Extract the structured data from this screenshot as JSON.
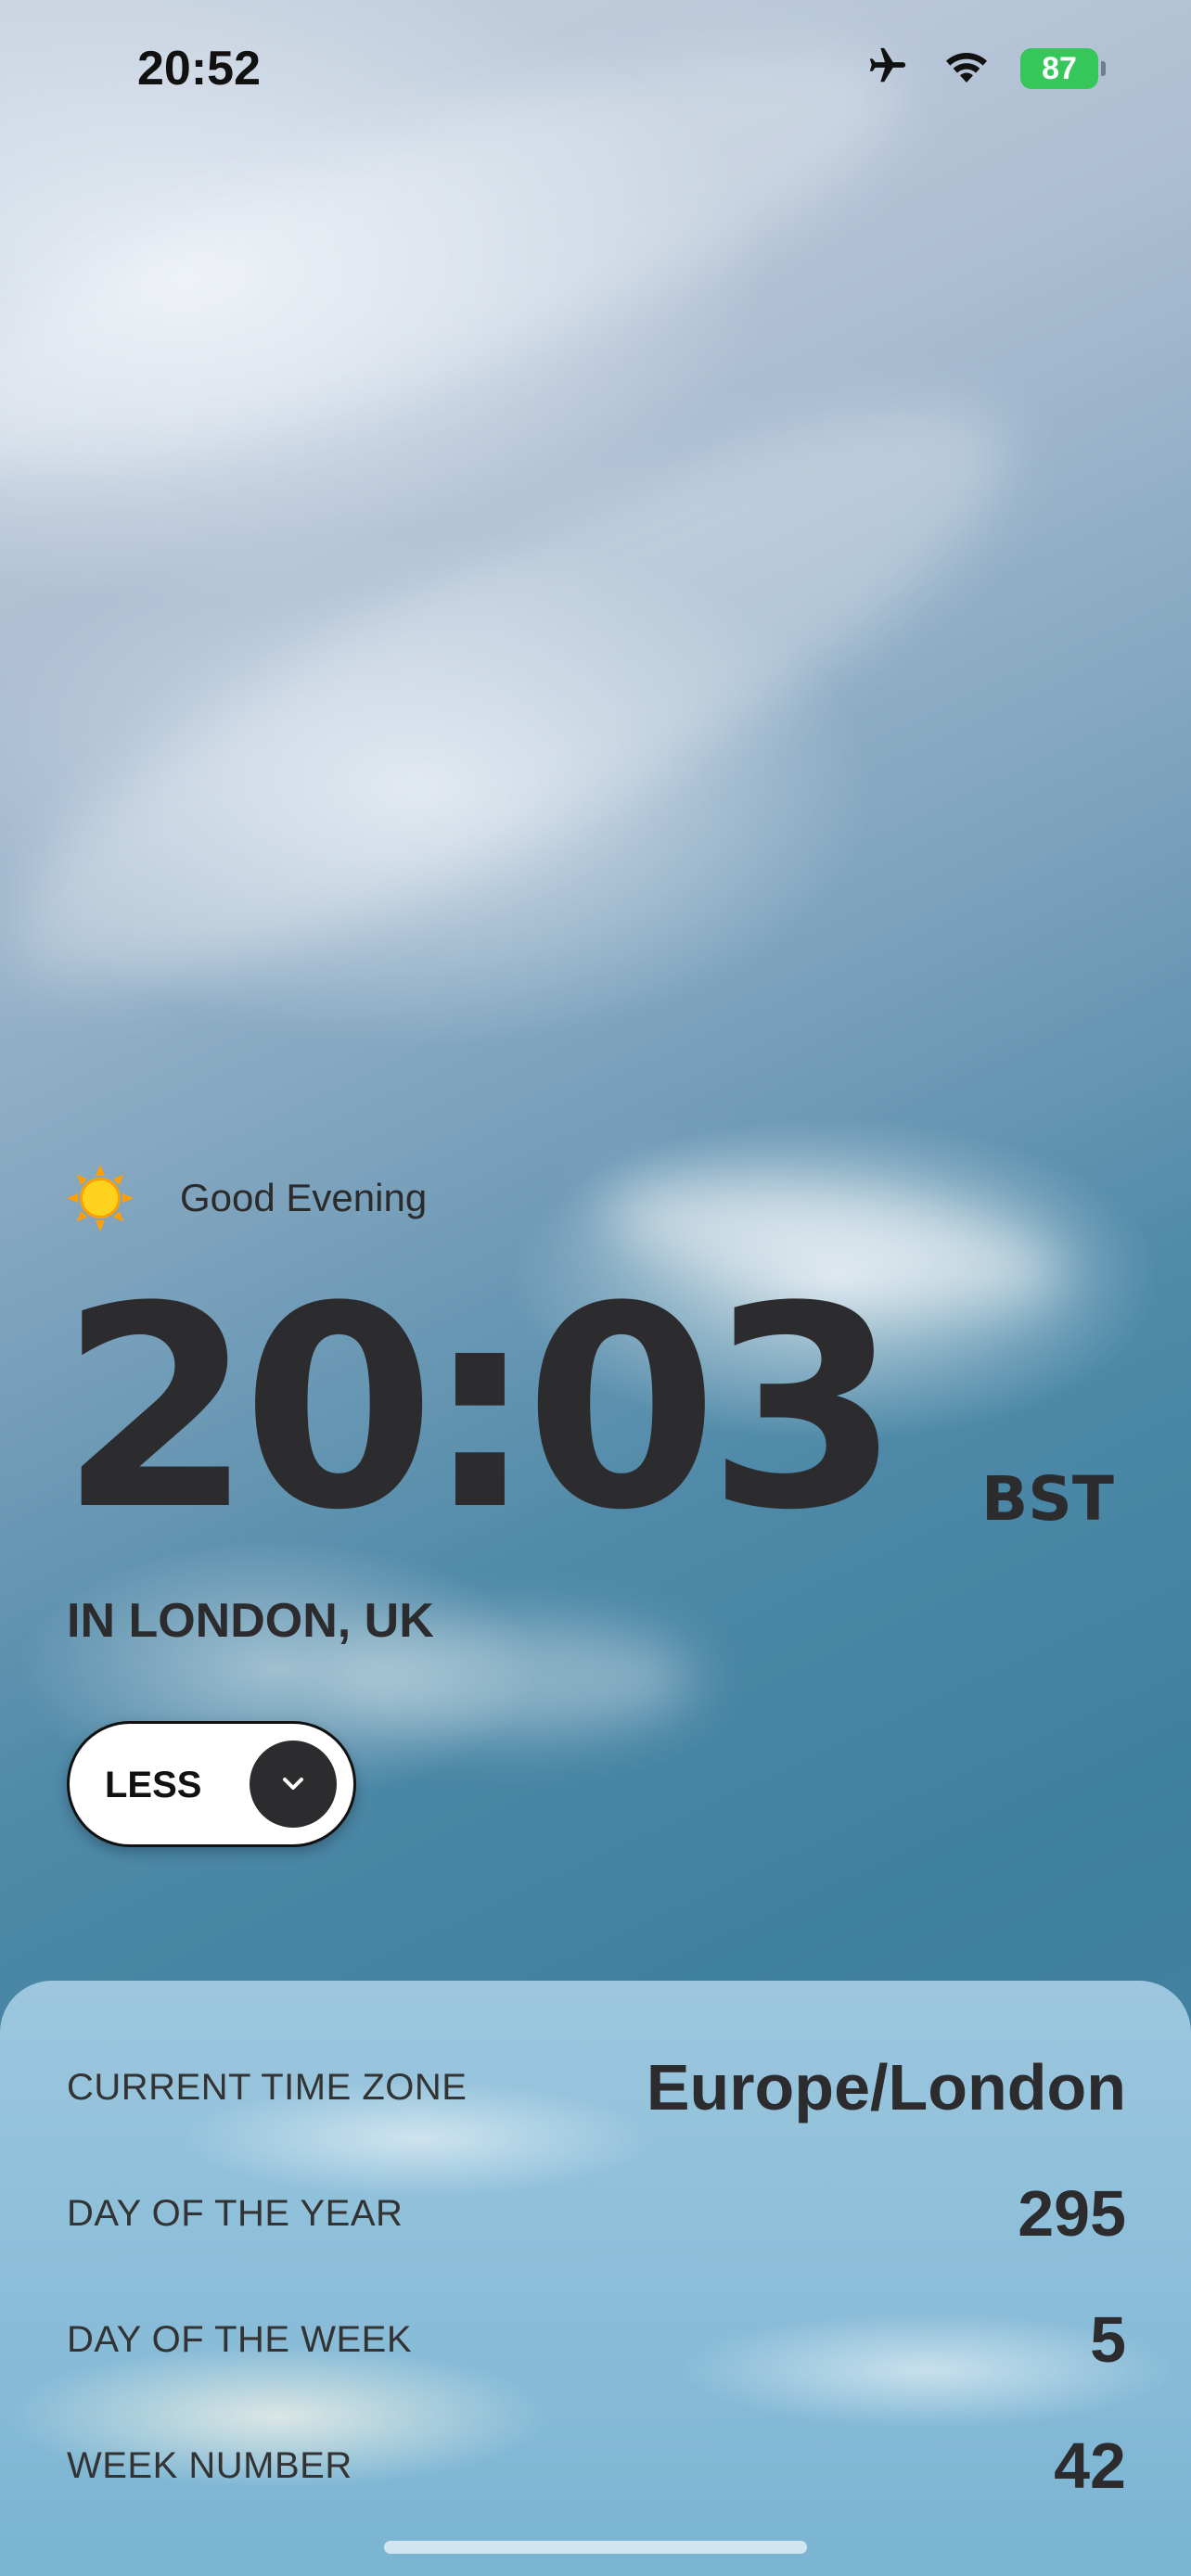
{
  "status_bar": {
    "time": "20:52",
    "battery_percent": "87",
    "airplane_mode_icon": "airplane-icon",
    "wifi_icon": "wifi-icon",
    "battery_color": "#35c759"
  },
  "greeting": {
    "icon": "sun-icon",
    "text": "Good Evening"
  },
  "clock": {
    "time": "20:03",
    "timezone_abbr": "BST",
    "location": "IN LONDON, UK"
  },
  "toggle_button": {
    "label": "LESS",
    "icon": "chevron-down-icon"
  },
  "details": {
    "rows": [
      {
        "label": "CURRENT TIME ZONE",
        "value": "Europe/London"
      },
      {
        "label": "DAY OF THE YEAR",
        "value": "295"
      },
      {
        "label": "DAY OF THE WEEK",
        "value": "5"
      },
      {
        "label": "WEEK NUMBER",
        "value": "42"
      }
    ]
  },
  "colors": {
    "text_dark": "#2c2c2e",
    "sun": "#ffc107"
  }
}
